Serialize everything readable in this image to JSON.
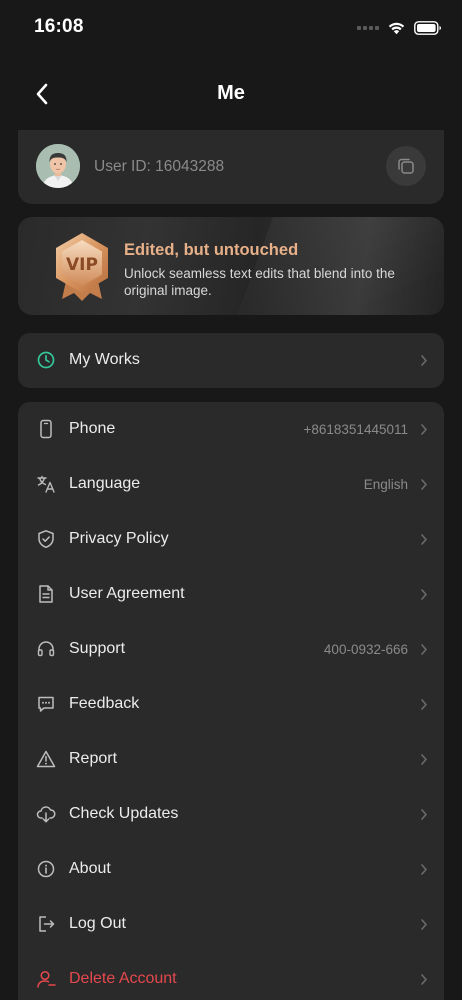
{
  "status_bar": {
    "time": "16:08"
  },
  "nav": {
    "title": "Me"
  },
  "user": {
    "id_label": "User ID: 16043288"
  },
  "vip": {
    "badge_text": "VIP",
    "title": "Edited, but untouched",
    "description": "Unlock seamless text edits that blend into the original image."
  },
  "works": {
    "label": "My Works",
    "icon": "clock-icon"
  },
  "settings": {
    "items": [
      {
        "label": "Phone",
        "value": "+8618351445011",
        "icon": "phone-icon"
      },
      {
        "label": "Language",
        "value": "English",
        "icon": "translate-icon"
      },
      {
        "label": "Privacy Policy",
        "value": "",
        "icon": "shield-icon"
      },
      {
        "label": "User Agreement",
        "value": "",
        "icon": "document-icon"
      },
      {
        "label": "Support",
        "value": "400-0932-666",
        "icon": "headset-icon"
      },
      {
        "label": "Feedback",
        "value": "",
        "icon": "message-icon"
      },
      {
        "label": "Report",
        "value": "",
        "icon": "warning-icon"
      },
      {
        "label": "Check Updates",
        "value": "",
        "icon": "cloud-download-icon"
      },
      {
        "label": "About",
        "value": "",
        "icon": "info-icon"
      },
      {
        "label": "Log Out",
        "value": "",
        "icon": "logout-icon"
      },
      {
        "label": "Delete Account",
        "value": "",
        "icon": "delete-user-icon"
      }
    ]
  },
  "colors": {
    "background": "#181818",
    "card": "#2a2a2a",
    "accent_green": "#34c79a",
    "vip_gold": "#e7b088",
    "danger": "#e5484d"
  }
}
